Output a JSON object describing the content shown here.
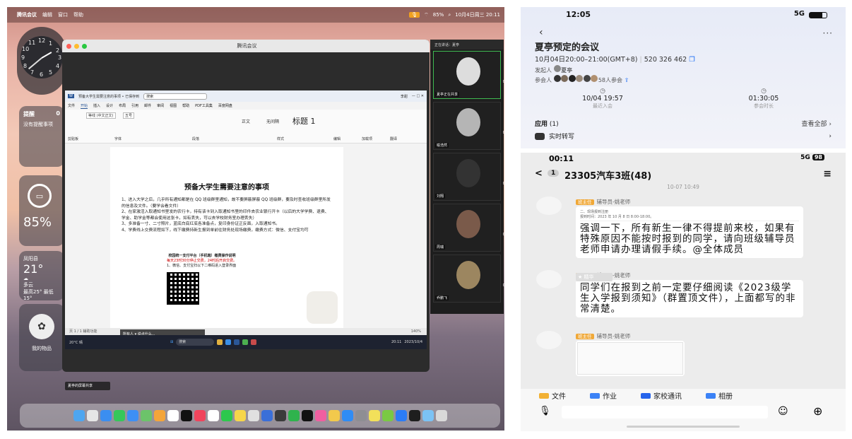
{
  "mac": {
    "menubar": {
      "items": [
        "腾讯会议",
        "编辑",
        "窗口",
        "帮助"
      ],
      "right": "85%",
      "datetime": "10月4日周三 20:11"
    },
    "clock": {
      "numbers": [
        "12",
        "1",
        "2",
        "3",
        "4",
        "5",
        "6",
        "7",
        "8",
        "9",
        "10",
        "11"
      ]
    },
    "reminders": {
      "title": "提醒",
      "count": "0",
      "empty": "没有提醒事项"
    },
    "battery": {
      "percent": "85%"
    },
    "weather": {
      "location": "凤阳县",
      "temp": "21°",
      "condition": "多云",
      "range": "最高25° 最低15°"
    },
    "widget_label": "我的物品",
    "meeting": {
      "window_title": "腾讯会议",
      "word": {
        "doc_name": "预备大学生需要注意的事项 • 已保存到",
        "search": "搜索",
        "user": "李甜",
        "tabs": [
          "文件",
          "开始",
          "插入",
          "设计",
          "布局",
          "引用",
          "邮件",
          "审阅",
          "视图",
          "帮助",
          "PDF工具集",
          "百度网盘"
        ],
        "active_tab": "开始",
        "font": "等线 (中文正文)",
        "size": "五号",
        "styles": [
          "正文",
          "无间隔",
          "标题 1"
        ],
        "ribbon_groups": [
          "剪贴板",
          "字体",
          "段落",
          "样式",
          "编辑",
          "加载项",
          "翻译"
        ],
        "doc_title": "预备大学生需要注意的事项",
        "paragraphs": [
          "1、进入大学之后，几乎所有通知都是在 QQ 班级群里通知，故不要屏蔽屏蔽 QQ 班级群，要及时查收班级群里所发的信息及文件。（要学会看文件）",
          "2、在家激活入取通知书里发的农行卡，持有该卡到入取通知书里的印件去农业银行开卡（以后的大学学费、退费、学金、助学金等都会使用这张卡，如有丢失，可以去学校财务室办理丢失）",
          "3、多准备一寸、二寸照片，蓝底白底红底各准备点，复印身份证正反面，入取通知书。",
          "4、学费线上交费流程如下，线下缴费持新生报到单前往财务处现场缴费，缴费方式：微信、支付宝均可"
        ],
        "pay": {
          "title": "校园统一支付平台（手机端）缴费操作说明",
          "warn": "每天23时30分停止交费，24时后开启交费。",
          "step": "1、微信、支付宝扫以下二维码进入登录界面"
        },
        "statusbar": "页 1 / 1   辅助功能",
        "zoom": "140%"
      },
      "taskbar": {
        "weather": "20°C 晴",
        "search": "搜索",
        "time": "20:11",
        "date": "2023/10/4"
      },
      "overlay": "所有人 ▾  说点什么..."
    },
    "panel": {
      "header": "正在讲话：夏亭",
      "tiles": [
        {
          "name": "夏亭正在共享",
          "num": "03"
        },
        {
          "name": "喻浩然",
          "num": "03"
        },
        {
          "name": "刘翔",
          "num": "04"
        },
        {
          "name": "周瑞",
          "num": "04"
        },
        {
          "name": "乔鹏飞",
          "num": "03"
        }
      ]
    },
    "share_chip": "夏亭的屏幕共享"
  },
  "phone": {
    "status1": {
      "time": "12:05",
      "network": "5G"
    },
    "meeting_title": "夏亭预定的会议",
    "meeting_time": "10月04日20:00–21:00(GMT+8)",
    "meeting_id": "520 326 462",
    "host_label": "发起人",
    "host": "夏亭",
    "participants": "58人参会",
    "stats": [
      {
        "value": "10/04 19:57",
        "label": "最近入会"
      },
      {
        "value": "01:30:05",
        "label": "参会时长"
      }
    ],
    "apps_label": "应用",
    "apps_count": "(1)",
    "view_all": "查看全部",
    "app_item": "实时转写",
    "status2": {
      "time": "00:11",
      "network": "5G",
      "battery": "98"
    },
    "group_badge": "1",
    "group_name": "23305汽车3班(48)",
    "timestamp": "10-07 10:49",
    "sender_tag": "班主任",
    "sender": "辅导员-姚老师",
    "doc_caption": "二、现场报到注册",
    "doc_time": "报到时间：2023 年 10 月 8 日 8:00-18:00。",
    "msg1": "强调一下，所有新生一律不得提前来校，如果有特殊原因不能按时报到的同学，请向班级辅导员老师申请办理请假手续。@全体成员",
    "essence": "精华",
    "msg2": "同学们在报到之前一定要仔细阅读《2023级学生入学报到须知》（群置顶文件），上面都写的非常清楚。",
    "tabs": [
      "文件",
      "作业",
      "家校通讯",
      "相册"
    ],
    "colors": {
      "accent": "#1a6cf5",
      "tag": "#f0a837"
    }
  }
}
